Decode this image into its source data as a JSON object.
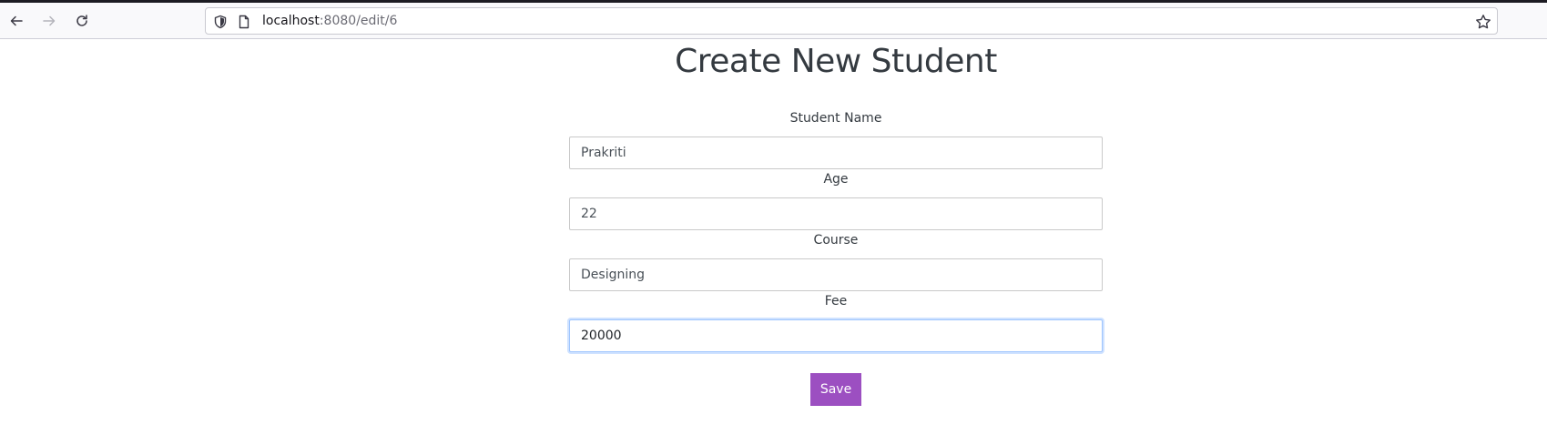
{
  "browser": {
    "url_host": "localhost",
    "url_path": ":8080/edit/6",
    "icons": [
      "back-arrow-icon",
      "forward-arrow-icon",
      "reload-icon",
      "shield-icon",
      "page-icon",
      "bookmark-star-icon"
    ]
  },
  "form": {
    "title": "Create New Student",
    "fields": [
      {
        "label": "Student Name",
        "value": "Prakriti"
      },
      {
        "label": "Age",
        "value": "22"
      },
      {
        "label": "Course",
        "value": "Designing"
      },
      {
        "label": "Fee",
        "value": "20000"
      }
    ],
    "save_label": "Save"
  },
  "colors": {
    "button": "#9c4fc1",
    "focus_border": "#9ec5fe",
    "title": "#343a40"
  }
}
